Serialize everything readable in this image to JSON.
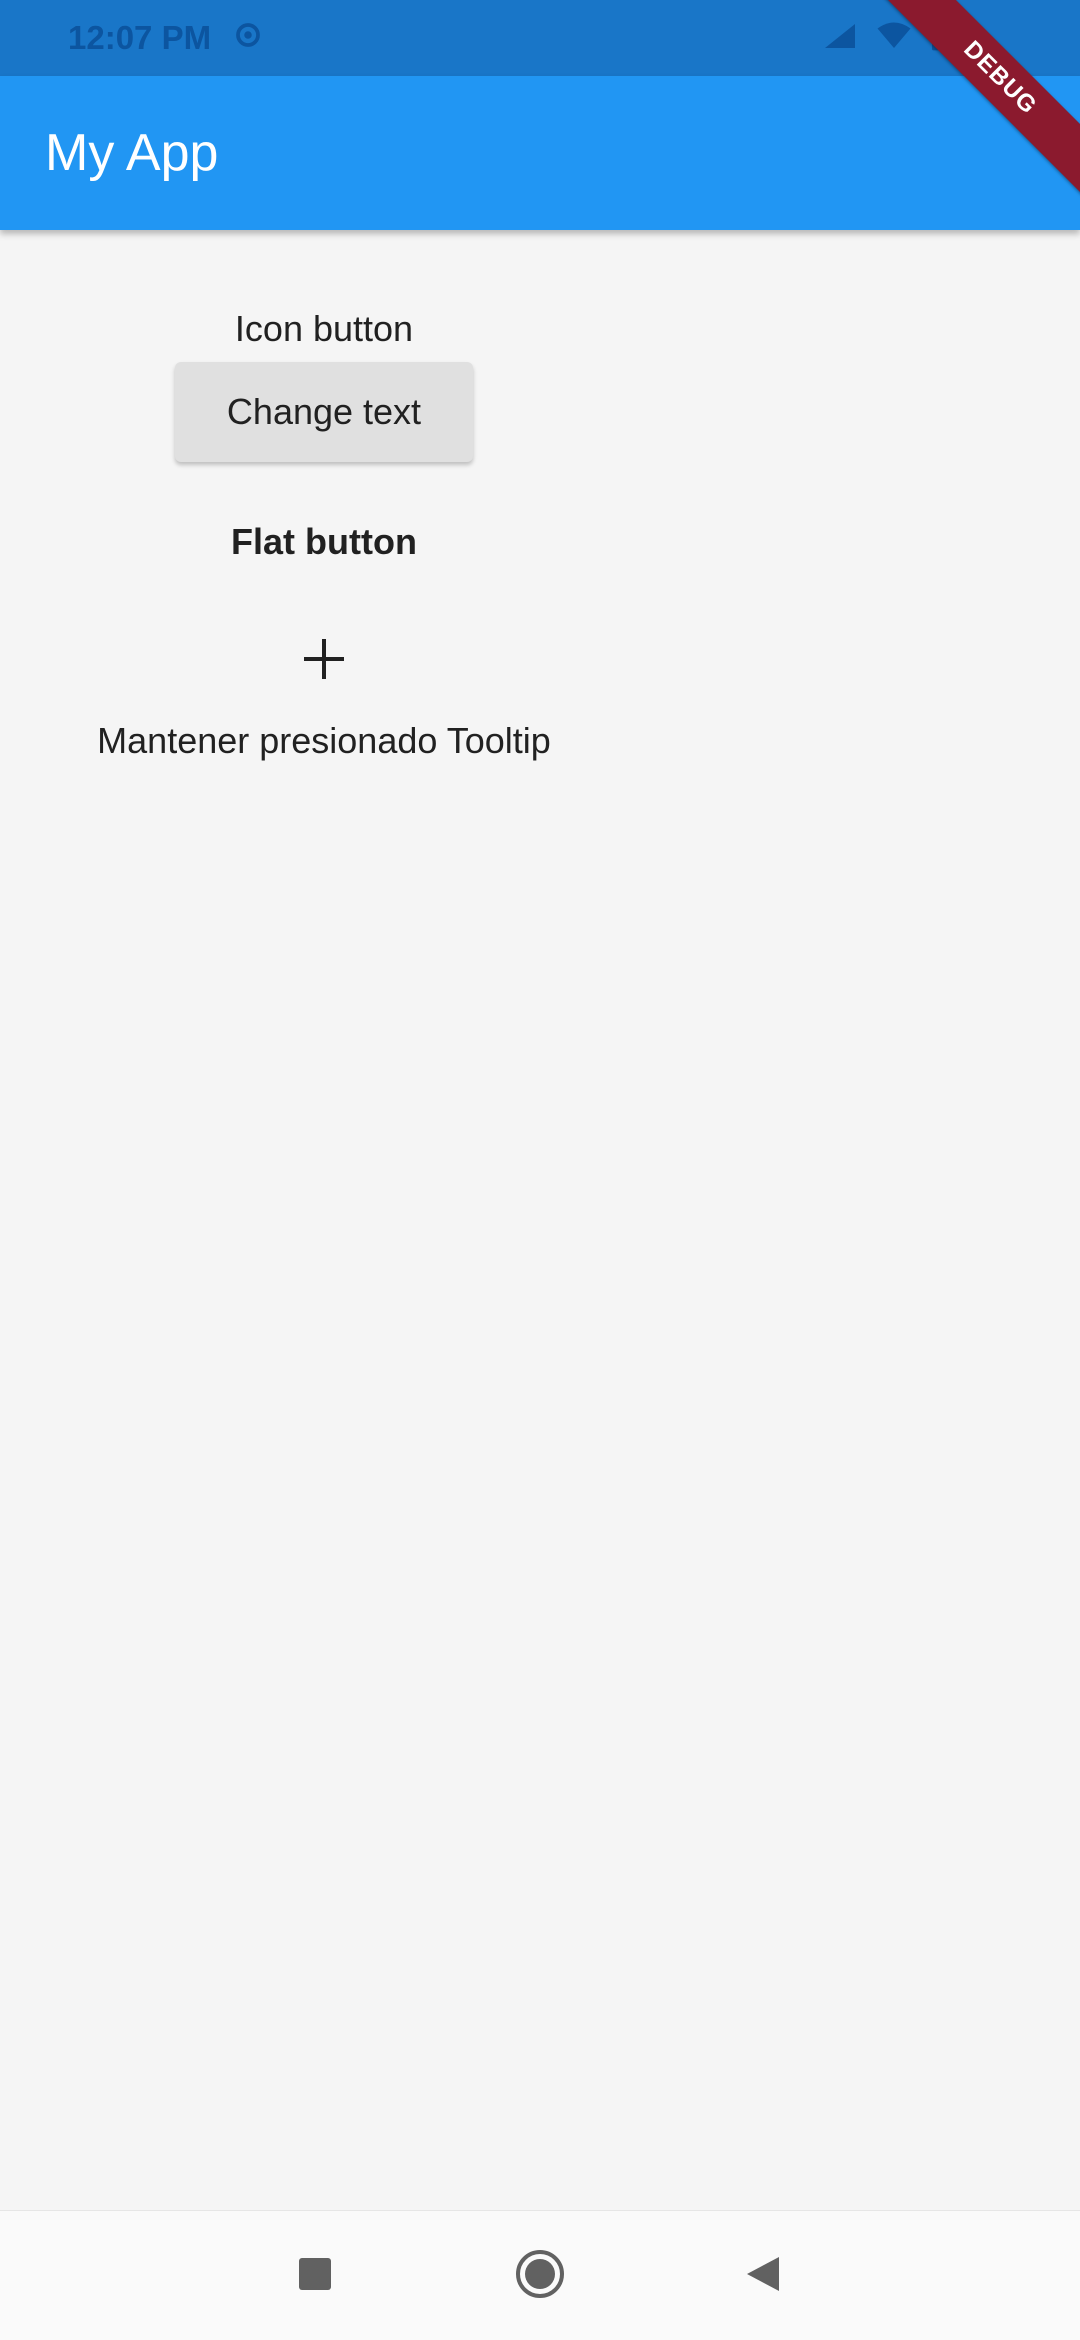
{
  "status_bar": {
    "time": "12:07 PM",
    "icons": [
      "settings-icon",
      "signal-icon",
      "wifi-icon",
      "battery-icon"
    ]
  },
  "app_bar": {
    "title": "My App"
  },
  "debug_banner": {
    "label": "DEBUG"
  },
  "content": {
    "icon_button_label": "Icon button",
    "raised_button_label": "Change text",
    "flat_button_label": "Flat button",
    "plus_icon": "add-icon",
    "tooltip_label": "Mantener presionado Tooltip"
  },
  "nav_bar": {
    "buttons": [
      "recents-square-icon",
      "home-circle-icon",
      "back-triangle-icon"
    ]
  },
  "colors": {
    "status_bar": "#1976c8",
    "app_bar": "#2196f3",
    "background": "#f5f5f5",
    "debug_banner": "#8b1a2e",
    "raised_button": "#e0e0e0"
  }
}
